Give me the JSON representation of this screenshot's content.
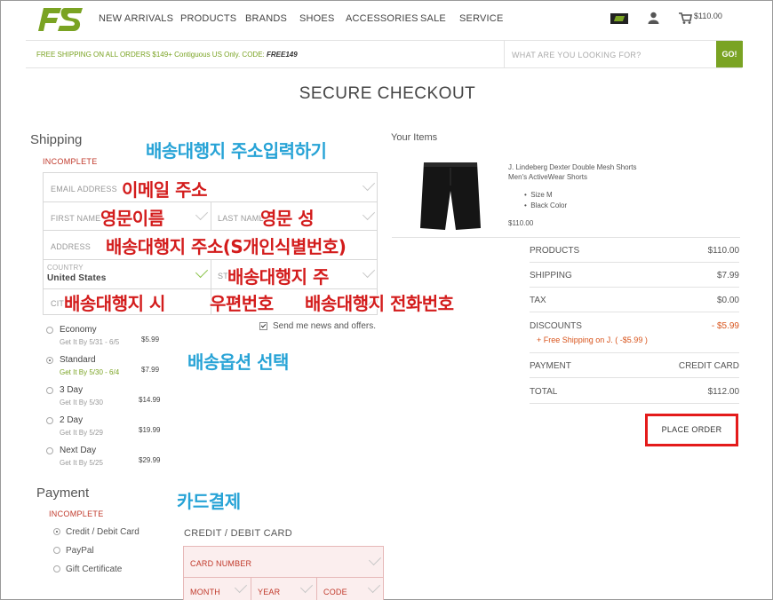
{
  "header": {
    "nav": [
      "NEW ARRIVALS",
      "PRODUCTS",
      "BRANDS",
      "SHOES",
      "ACCESSORIES",
      "SALE",
      "SERVICE"
    ],
    "cart_total": "$110.00",
    "promo_text": "FREE SHIPPING ON ALL ORDERS $149+ Contiguous US Only. CODE:",
    "promo_code": "FREE149",
    "search_placeholder": "WHAT ARE YOU LOOKING FOR?",
    "go_label": "GO!",
    "brand_color": "#7aa323"
  },
  "page_title": "SECURE CHECKOUT",
  "shipping": {
    "heading": "Shipping",
    "status": "INCOMPLETE",
    "fields": {
      "email": "EMAIL ADDRESS",
      "first_name": "FIRST NAME",
      "last_name": "LAST NAME",
      "address": "ADDRESS",
      "country_label": "COUNTRY",
      "country_value": "United States",
      "state": "ST",
      "city": "CIT"
    },
    "newsletter": "Send me news and offers.",
    "options": [
      {
        "name": "Economy",
        "eta": "Get It By 5/31 - 6/5",
        "price": "$5.99",
        "selected": false
      },
      {
        "name": "Standard",
        "eta": "Get It By 5/30 - 6/4",
        "price": "$7.99",
        "selected": true
      },
      {
        "name": "3 Day",
        "eta": "Get It By 5/30",
        "price": "$14.99",
        "selected": false
      },
      {
        "name": "2 Day",
        "eta": "Get It By 5/29",
        "price": "$19.99",
        "selected": false
      },
      {
        "name": "Next Day",
        "eta": "Get It By 5/25",
        "price": "$29.99",
        "selected": false
      }
    ]
  },
  "payment": {
    "heading": "Payment",
    "status": "INCOMPLETE",
    "methods": [
      "Credit / Debit Card",
      "PayPal",
      "Gift Certificate"
    ],
    "card_heading": "CREDIT / DEBIT CARD",
    "card_number": "CARD NUMBER",
    "month": "MONTH",
    "year": "YEAR",
    "code": "CODE"
  },
  "items": {
    "heading": "Your Items",
    "product_name": "J. Lindeberg Dexter Double Mesh Shorts",
    "product_sub": "Men's ActiveWear Shorts",
    "attrs": [
      "Size M",
      "Black Color"
    ],
    "price": "$110.00"
  },
  "summary": {
    "rows": [
      {
        "k": "PRODUCTS",
        "v": "$110.00"
      },
      {
        "k": "SHIPPING",
        "v": "$7.99"
      },
      {
        "k": "TAX",
        "v": "$0.00"
      },
      {
        "k": "DISCOUNTS",
        "v": "- $5.99"
      },
      {
        "k": "PAYMENT",
        "v": "CREDIT CARD"
      },
      {
        "k": "TOTAL",
        "v": "$112.00"
      }
    ],
    "discount_note": "+ Free Shipping on J. ( -$5.99 )",
    "place_order": "PLACE ORDER"
  },
  "annotations": {
    "shipping_address": "배송대행지 주소입력하기",
    "email": "이메일 주소",
    "first_name": "영문이름",
    "last_name": "영문 성",
    "address": "배송대행지 주소(S개인식별번호)",
    "state": "배송대행지 주",
    "city": "배송대행지 시",
    "zip": "우편번호",
    "phone": "배송대행지 전화번호",
    "ship_option": "배송옵션 선택",
    "card": "카드결제"
  }
}
